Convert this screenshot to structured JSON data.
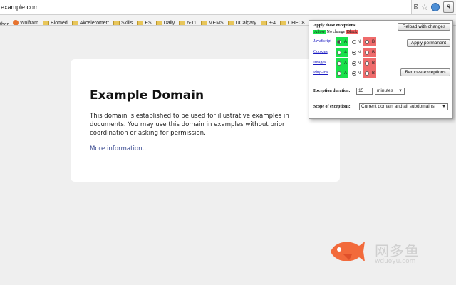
{
  "browser": {
    "url": "example.com",
    "bookmarks": [
      {
        "label": "ther",
        "icon": "none"
      },
      {
        "label": "Wolfram",
        "icon": "wolfram-icon"
      },
      {
        "label": "Biomed",
        "icon": "folder-icon"
      },
      {
        "label": "Akcelerometr",
        "icon": "folder-icon"
      },
      {
        "label": "Skills",
        "icon": "folder-icon"
      },
      {
        "label": "ES",
        "icon": "folder-icon"
      },
      {
        "label": "Daily",
        "icon": "folder-icon"
      },
      {
        "label": "6-11",
        "icon": "folder-icon"
      },
      {
        "label": "MEMS",
        "icon": "folder-icon"
      },
      {
        "label": "UCalgary",
        "icon": "folder-icon"
      },
      {
        "label": "3-4",
        "icon": "folder-icon"
      },
      {
        "label": "CHECK",
        "icon": "folder-icon"
      },
      {
        "label": "",
        "icon": "bookmark-icon"
      }
    ],
    "script_ext_glyph": "S"
  },
  "page": {
    "title": "Example Domain",
    "body": "This domain is established to be used for illustrative examples in documents. You may use this domain in examples without prior coordination or asking for permission.",
    "link": "More information..."
  },
  "popup": {
    "heading": "Apply these exceptions:",
    "legend": {
      "allow": "Allow",
      "nochange": "No change",
      "block": "Block"
    },
    "buttons": {
      "reload": "Reload with changes",
      "apply": "Apply permanent",
      "remove": "Remove exceptions"
    },
    "rows": [
      {
        "label": "JavaScript",
        "selected": "A"
      },
      {
        "label": "Cookies",
        "selected": "N"
      },
      {
        "label": "Images",
        "selected": "N"
      },
      {
        "label": "Plug-Ins",
        "selected": "N"
      }
    ],
    "option_letters": {
      "allow": "A",
      "nochange": "N",
      "block": "B"
    },
    "duration_label": "Exception duration:",
    "duration_value": "15",
    "duration_unit": "minutes",
    "scope_label": "Scope of exceptions:",
    "scope_value": "Current domain and all subdomains",
    "colors": {
      "allow": "#19e24b",
      "block": "#ef6b6b"
    }
  },
  "watermark": {
    "brand_cn": "网多鱼",
    "url": "wduoyu.com"
  }
}
